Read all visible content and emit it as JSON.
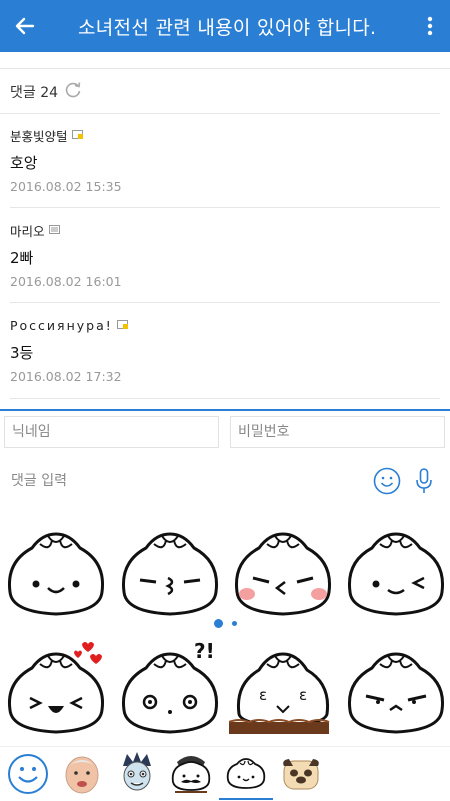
{
  "header": {
    "title": "소녀전선 관련 내용이 있어야 합니다.",
    "accent_color": "#2a7fd4"
  },
  "comments": {
    "count_label": "댓글 24",
    "items": [
      {
        "author": "분홍빛양털",
        "text": "호앙",
        "time": "2016.08.02 15:35",
        "badge_color": "#f2c200"
      },
      {
        "author": "마리오",
        "text": "2빠",
        "time": "2016.08.02 16:01",
        "badge_color": "#bbbbbb"
      },
      {
        "author": "Россиянура!",
        "text": "3등",
        "time": "2016.08.02 17:32",
        "badge_color": "#f2c200"
      }
    ]
  },
  "form": {
    "nickname_placeholder": "닉네임",
    "password_placeholder": "비밀번호",
    "comment_placeholder": "댓글 입력"
  },
  "stickers": {
    "page_indicator": {
      "pages": 2,
      "current": 1
    },
    "items": [
      "dumpling-smile",
      "dumpling-kiss",
      "dumpling-blush-kiss",
      "dumpling-wink",
      "dumpling-hearts-laugh",
      "dumpling-surprised",
      "dumpling-on-table",
      "dumpling-grumpy"
    ]
  },
  "sticker_tabs": {
    "selected_index": 4,
    "items": [
      "smiley-icon",
      "face-photo-icon",
      "vampire-icon",
      "mustache-dumpling-icon",
      "dumpling-icon",
      "pug-icon"
    ]
  }
}
